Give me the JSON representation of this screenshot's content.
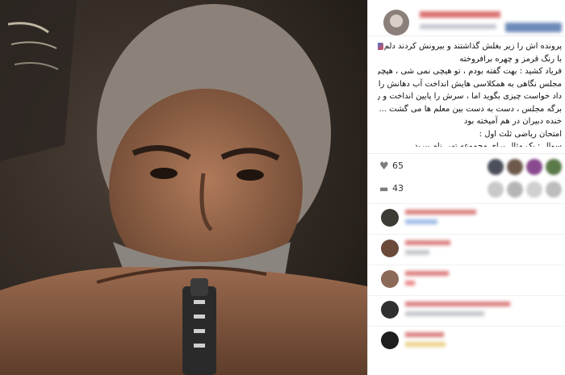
{
  "post": {
    "caption_lines": [
      "پرونده اش را زیر بغلش گذاشتند و بیرونش کردند دلم",
      "با رنگ قرمز و چهره برافروخته",
      "فریاد کشید : بهت گفته بودم ، تو هیچی نمی شی ، هیچی...",
      "مجلس نگاهی به همکلاسی هایش انداخت آب دهانش را فورت",
      "داد خواست چیزی بگوید اما ، سرش را پایین انداخت و رفت",
      "برگه مجلس ، دست به دست بین معلم ها می گشت ... اشک و",
      "خنده دبیران در هم آمیخته بود",
      "امتحان ریاضی ثلث اول :",
      "سوال : یک مثال برای مجموعه تهی نام ببرید"
    ],
    "likes_count": "65",
    "comments_count": "43"
  },
  "colors": {
    "accent": "#c33333",
    "icon_gray": "#7d7d7d"
  },
  "icons": {
    "like": "heart-icon",
    "comment": "comment-icon"
  }
}
